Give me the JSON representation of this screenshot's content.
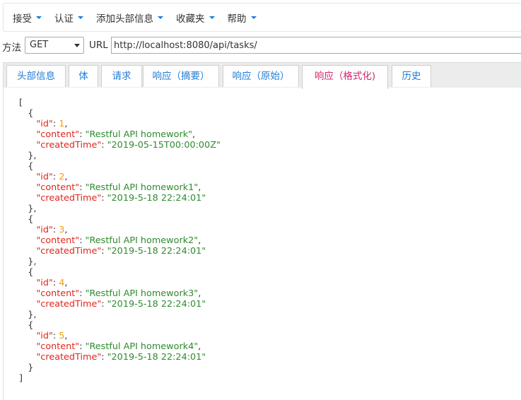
{
  "menu": [
    {
      "label": "接受"
    },
    {
      "label": "认证"
    },
    {
      "label": "添加头部信息"
    },
    {
      "label": "收藏夹"
    },
    {
      "label": "帮助"
    }
  ],
  "request": {
    "method_label": "方法",
    "method_value": "GET",
    "url_label": "URL",
    "url_value": "http://localhost:8080/api/tasks/"
  },
  "tabs": [
    {
      "label": "头部信息",
      "active": false
    },
    {
      "label": "体",
      "active": false
    },
    {
      "label": "请求",
      "active": false
    },
    {
      "label": "响应（摘要）",
      "active": false
    },
    {
      "label": "响应（原始）",
      "active": false
    },
    {
      "label": "响应（格式化)",
      "active": true
    },
    {
      "label": "历史",
      "active": false
    }
  ],
  "response": {
    "items": [
      {
        "id": 1,
        "content": "Restful API homework",
        "createdTime": "2019-05-15T00:00:00Z"
      },
      {
        "id": 2,
        "content": "Restful API homework1",
        "createdTime": "2019-5-18 22:24:01"
      },
      {
        "id": 3,
        "content": "Restful API homework2",
        "createdTime": "2019-5-18 22:24:01"
      },
      {
        "id": 4,
        "content": "Restful API homework3",
        "createdTime": "2019-5-18 22:24:01"
      },
      {
        "id": 5,
        "content": "Restful API homework4",
        "createdTime": "2019-5-18 22:24:01"
      }
    ]
  },
  "colors": {
    "accent": "#1f7bd8",
    "active_tab": "#d6246e",
    "json_key": "#e0261b",
    "json_number": "#f39c12",
    "json_string": "#2e8b2e"
  }
}
